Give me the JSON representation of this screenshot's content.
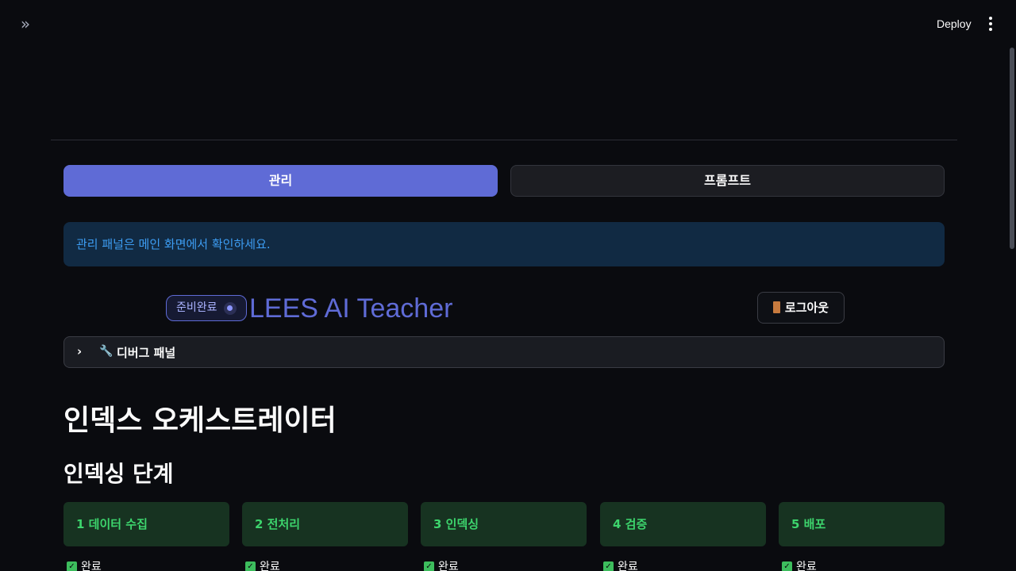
{
  "toolbar": {
    "deploy_label": "Deploy",
    "expand_icon": "»"
  },
  "tabs": [
    {
      "label": "관리",
      "active": true
    },
    {
      "label": "프롬프트",
      "active": false
    }
  ],
  "info": {
    "message": "관리 패널은 메인 화면에서 확인하세요."
  },
  "header": {
    "status_label": "준비완료",
    "app_title": "LEES AI Teacher",
    "logout_label": "로그아웃"
  },
  "debug_panel": {
    "label": "디버그 패널",
    "icon": "🔧"
  },
  "page": {
    "title": "인덱스 오케스트레이터",
    "section_title": "인덱싱 단계"
  },
  "steps": [
    {
      "label": "1 데이터 수집",
      "status": "완료"
    },
    {
      "label": "2 전처리",
      "status": "완료"
    },
    {
      "label": "3 인덱싱",
      "status": "완료"
    },
    {
      "label": "4 검증",
      "status": "완료"
    },
    {
      "label": "5 배포",
      "status": "완료"
    }
  ],
  "colors": {
    "accent": "#5f6bd6",
    "info_bg": "#112a43",
    "info_text": "#3d9df3",
    "success_bg": "#173321",
    "success_text": "#3dd56d"
  }
}
